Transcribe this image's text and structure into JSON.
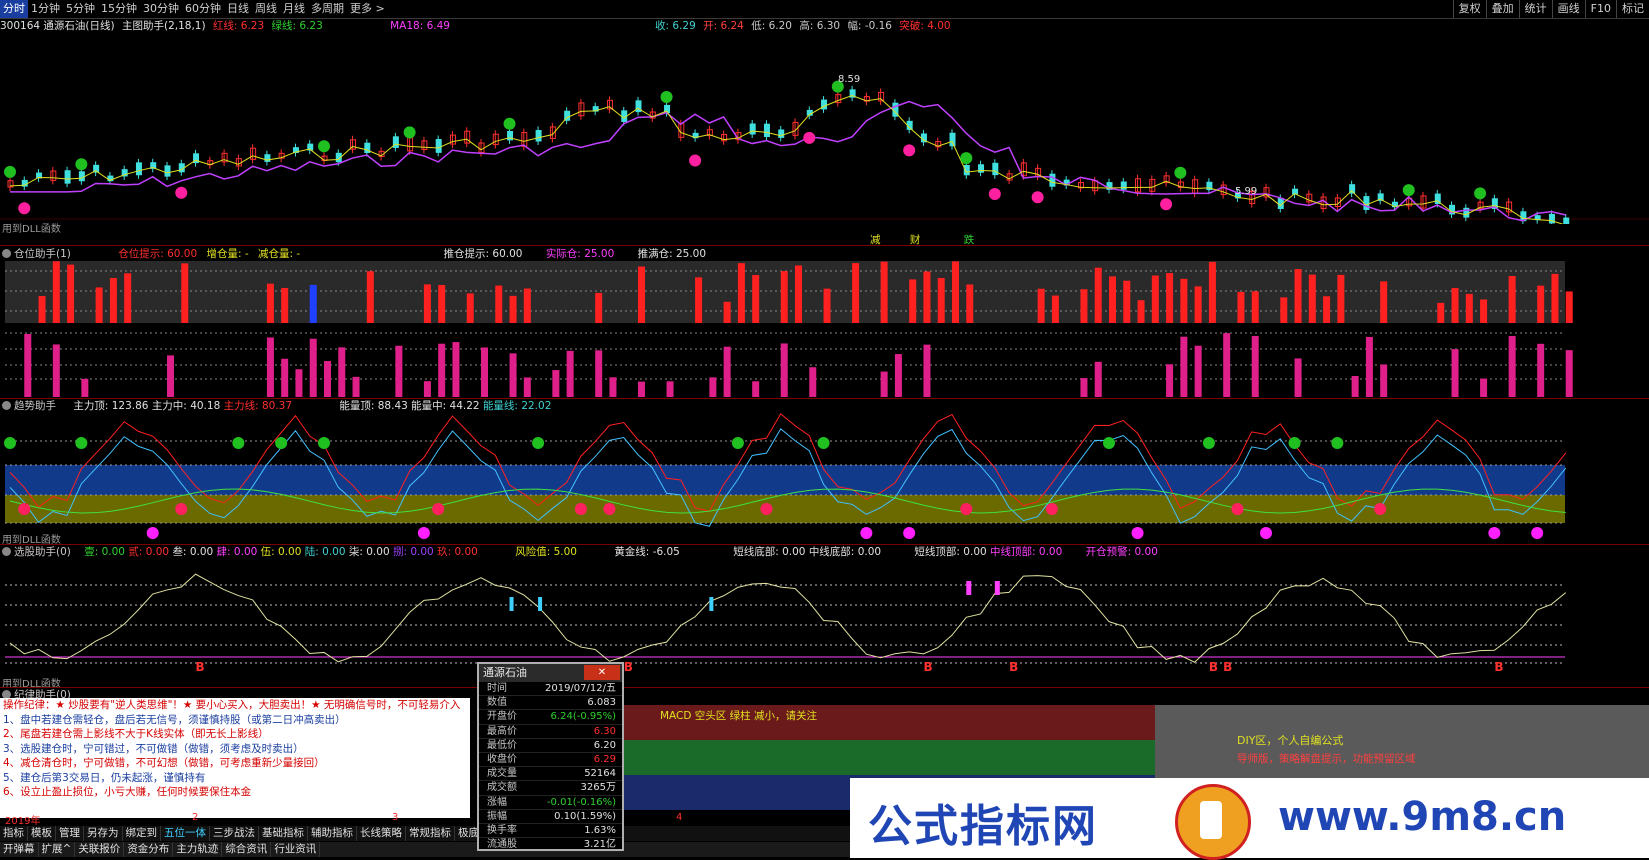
{
  "topbar": {
    "timeframes": [
      "分时",
      "1分钟",
      "5分钟",
      "15分钟",
      "30分钟",
      "60分钟",
      "日线",
      "周线",
      "月线",
      "多周期",
      "更多 >"
    ],
    "active_index": 0,
    "right_buttons": [
      "复权",
      "叠加",
      "统计",
      "画线",
      "F10",
      "标记"
    ]
  },
  "main": {
    "stock_title": "300164 通源石油(日线)",
    "indicator": "主图助手(2,18,1)",
    "red_line": "红线: 6.23",
    "green_line": "绿线: 6.23",
    "ma": "MA18: 6.49",
    "close": "收: 6.29",
    "open": "开: 6.24",
    "low": "低: 6.20",
    "high": "高: 6.30",
    "change": "幅: -0.16",
    "breakout": "突破: 4.00",
    "high_marker": "8.59",
    "low_marker": "5.99",
    "dll_note": "用到DLL函数",
    "bottom_labels": [
      "减",
      "财",
      "跌"
    ]
  },
  "panel1": {
    "title": "仓位助手(1)",
    "items": [
      "仓位提示: 60.00",
      "增仓量: -",
      "减仓量: -",
      "推仓提示: 60.00",
      "实际仓: 25.00",
      "推满仓: 25.00"
    ]
  },
  "panel2": {
    "title": "趋势助手",
    "items": [
      "主力顶: 123.86",
      "主力中: 40.18",
      "主力线: 80.37",
      "能量顶: 88.43",
      "能量中: 44.22",
      "能量线: 22.02"
    ],
    "dll_note": "用到DLL函数"
  },
  "panel3": {
    "title": "选股助手(0)",
    "items": [
      "壹: 0.00",
      "贰: 0.00",
      "叁: 0.00",
      "肆: 0.00",
      "伍: 0.00",
      "陆: 0.00",
      "柒: 0.00",
      "捌: 0.00",
      "玖: 0.00",
      "风险值: 5.00",
      "黄金线: -6.05",
      "短线底部: 0.00",
      "中线底部: 0.00",
      "短线顶部: 0.00",
      "中线顶部: 0.00",
      "开仓预警: 0.00"
    ],
    "dll_note": "用到DLL函数"
  },
  "panel4": {
    "title": "纪律助手(0)",
    "macd_text": "MACD 空头区 绿柱 减小，请关注",
    "diy_title": "DIY区，个人自编公式",
    "diy_sub": "导师版，策略解盘提示，功能预留区域"
  },
  "notes": [
    "操作纪律：★ 炒股要有\"逆人类思维\"！★ 要小心买入，大胆卖出！★ 无明确信号时，不可轻易介入",
    "1、盘中若建仓需轻仓，盘后若无信号，须谨慎持股（或第二日冲高卖出）",
    "2、尾盘若建仓需上影线不大于K线实体（即无长上影线）",
    "3、选股建仓时，宁可错过，不可做错（做错，须考虑及时卖出）",
    "4、减仓清仓时，宁可做错，不可幻想（做错，可考虑重新少量接回）",
    "5、建仓后第3交易日，仍未起涨，谨慎持有",
    "6、设立止盈止损位，小亏大赚，任何时候要保住本金"
  ],
  "timeline": [
    "2019年",
    "2",
    "3",
    "4"
  ],
  "popup": {
    "title": "通源石油",
    "close": "✕",
    "rows": [
      {
        "k": "时间",
        "v": "2019/07/12/五"
      },
      {
        "k": "数值",
        "v": "6.083"
      },
      {
        "k": "开盘价",
        "v": "6.24(-0.95%)"
      },
      {
        "k": "最高价",
        "v": "6.30"
      },
      {
        "k": "最低价",
        "v": "6.20"
      },
      {
        "k": "收盘价",
        "v": "6.29"
      },
      {
        "k": "成交量",
        "v": "52164"
      },
      {
        "k": "成交额",
        "v": "3265万"
      },
      {
        "k": "涨幅",
        "v": "-0.01(-0.16%)"
      },
      {
        "k": "振幅",
        "v": "0.10(1.59%)"
      },
      {
        "k": "换手率",
        "v": "1.63%"
      },
      {
        "k": "流通股",
        "v": "3.21亿"
      }
    ]
  },
  "bottom_tabs_1": [
    "指标",
    "模板",
    "管理",
    "另存为",
    "绑定到",
    "五位一体",
    "三步战法",
    "基础指标",
    "辅助指标",
    "长线策略",
    "常规指标",
    "极底"
  ],
  "bottom_tabs_2": [
    "开弹幕",
    "扩展^",
    "关联报价",
    "资金分布",
    "主力轨迹",
    "综合资讯",
    "行业资讯"
  ],
  "watermark": {
    "cn": "公式指标网",
    "url": "www.9m8.cn"
  },
  "colors": {
    "red": "#ff2020",
    "green": "#20c020",
    "magenta": "#ff00ff",
    "blue_band": "#123a8a",
    "olive_band": "#6a6a00",
    "pink_bar": "#e0208a"
  }
}
